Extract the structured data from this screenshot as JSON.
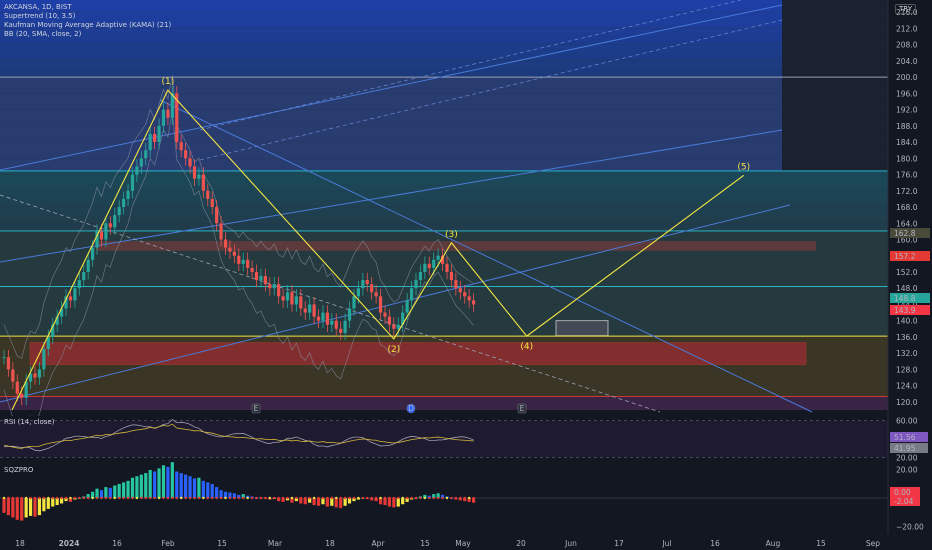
{
  "legend": {
    "symbol": "AKCANSA, 1D, BIST",
    "supertrend": "Supertrend (10, 3.5)",
    "kama": "Kaufman Moving Average Adaptive (KAMA) (21)",
    "bb": "BB (20, SMA, close, 2)"
  },
  "currency": "TRY",
  "rsi_title": "RSI (14, close)",
  "sqz_title": "SQZPRO",
  "wave_labels": [
    "(1)",
    "(2)",
    "(3)",
    "(4)",
    "(5)"
  ],
  "event_markers": [
    "E",
    "D",
    "E"
  ],
  "chart_data": [
    {
      "type": "candlestick",
      "title": "",
      "x_ticks": [
        "18",
        "2024",
        "16",
        "Feb",
        "15",
        "Mar",
        "18",
        "Apr",
        "15",
        "May",
        "20",
        "Jun",
        "17",
        "Jul",
        "16",
        "Aug",
        "15",
        "Sep"
      ],
      "y_ticks": [
        120,
        124,
        128,
        132,
        136,
        140,
        144,
        148,
        152,
        156,
        160,
        164,
        168,
        172,
        176,
        180,
        184,
        188,
        192,
        196,
        200,
        204,
        208,
        212,
        216
      ],
      "ylim": [
        118,
        219
      ],
      "price_badges": [
        {
          "text": "162.8",
          "color": "#4a4a3a"
        },
        {
          "text": "157.2",
          "color": "#e53935"
        },
        {
          "text": "148.8",
          "color": "#26a69a"
        },
        {
          "text": "143.9",
          "color": "#f23645"
        }
      ],
      "levels": [
        200,
        176.9,
        162.1,
        148.4,
        136.2,
        121.3
      ],
      "elliott_wave": [
        {
          "label": "(1)",
          "date_index": 37,
          "price": 196.8
        },
        {
          "label": "(2)",
          "date_index": 88,
          "price": 135.5
        },
        {
          "label": "(3)",
          "date_index": 101,
          "price": 159.2
        },
        {
          "label": "(4)",
          "date_index": 118,
          "price": 136.2
        },
        {
          "label": "(5)",
          "date_index": 167,
          "price": 175.8
        }
      ],
      "closes": [
        131,
        128,
        125,
        122,
        121,
        125,
        127,
        126,
        128,
        133,
        136,
        139,
        141,
        143,
        146,
        145,
        148,
        150,
        152,
        155,
        158,
        162,
        160,
        164,
        163,
        166,
        168,
        170,
        172,
        176,
        178,
        180,
        182,
        186,
        184,
        188,
        192,
        190,
        196,
        184,
        182,
        180,
        178,
        175,
        176,
        172,
        170,
        168,
        164,
        160,
        158,
        157,
        156,
        154,
        155,
        153,
        152,
        150,
        151,
        149,
        148,
        149,
        146,
        145,
        147,
        144,
        146,
        143,
        142,
        144,
        141,
        140,
        142,
        139,
        140,
        138,
        137,
        140,
        143,
        146,
        148,
        150,
        149,
        147,
        146,
        142,
        141,
        139,
        138,
        139,
        142,
        145,
        148,
        150,
        152,
        154,
        153,
        155,
        156,
        154,
        152,
        150,
        148,
        147,
        146,
        145,
        144
      ]
    },
    {
      "type": "line",
      "title": "RSI (14, close)",
      "y_ticks": [
        20,
        60
      ],
      "ylim": [
        15,
        65
      ],
      "badges": [
        {
          "text": "51.56",
          "color": "#7e57c2"
        },
        {
          "text": "41.95",
          "color": "#787b86"
        }
      ],
      "series": []
    },
    {
      "type": "bar",
      "title": "SQZPRO",
      "y_ticks": [
        20,
        -20
      ],
      "ylim": [
        -24,
        24
      ],
      "badges": [
        {
          "text": "0.00",
          "color": "#f23645"
        },
        {
          "text": "-2.04",
          "color": "#f23645"
        }
      ],
      "values": []
    }
  ]
}
